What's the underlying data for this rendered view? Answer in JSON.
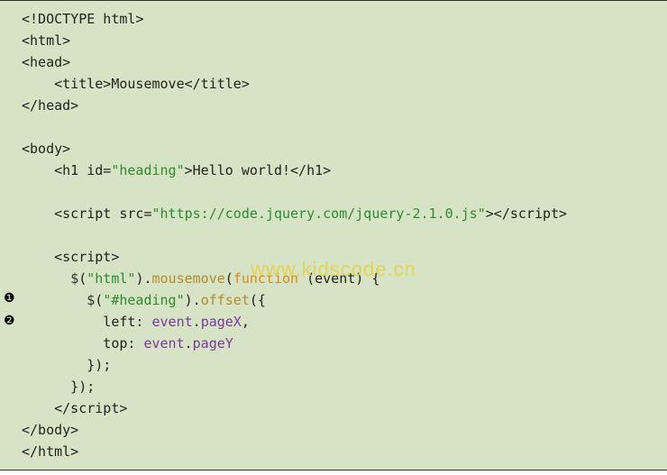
{
  "code": {
    "l01": "<!DOCTYPE html>",
    "l02": "<html>",
    "l03": "<head>",
    "l04a": "    <title>",
    "l04b": "Mousemove",
    "l04c": "</title>",
    "l05": "</head>",
    "l06": "",
    "l07": "<body>",
    "l08a": "    <h1 id=",
    "l08b": "\"heading\"",
    "l08c": ">",
    "l08d": "Hello world!",
    "l08e": "</h1>",
    "l09": "",
    "l10a": "    <script src=",
    "l10b": "\"https://code.jquery.com/jquery-2.1.0.js\"",
    "l10c": "></script>",
    "l11": "",
    "l12": "    <script>",
    "l13a": "      ",
    "l13b": "$",
    "l13c": "(",
    "l13d": "\"html\"",
    "l13e": ").",
    "l13f": "mousemove",
    "l13g": "(",
    "l13h": "function",
    "l13i": " (event) {",
    "l14a": "        ",
    "l14b": "$",
    "l14c": "(",
    "l14d": "\"#heading\"",
    "l14e": ").",
    "l14f": "offset",
    "l14g": "({",
    "l15a": "          left: ",
    "l15b": "event",
    "l15c": ".",
    "l15d": "pageX",
    "l15e": ",",
    "l16a": "          top: ",
    "l16b": "event",
    "l16c": ".",
    "l16d": "pageY",
    "l17": "        });",
    "l18": "      });",
    "l19": "    </script>",
    "l20": "</body>",
    "l21": "</html>"
  },
  "callouts": {
    "c1": "❶",
    "c2": "❷"
  },
  "watermark": "www.kidscode.cn"
}
